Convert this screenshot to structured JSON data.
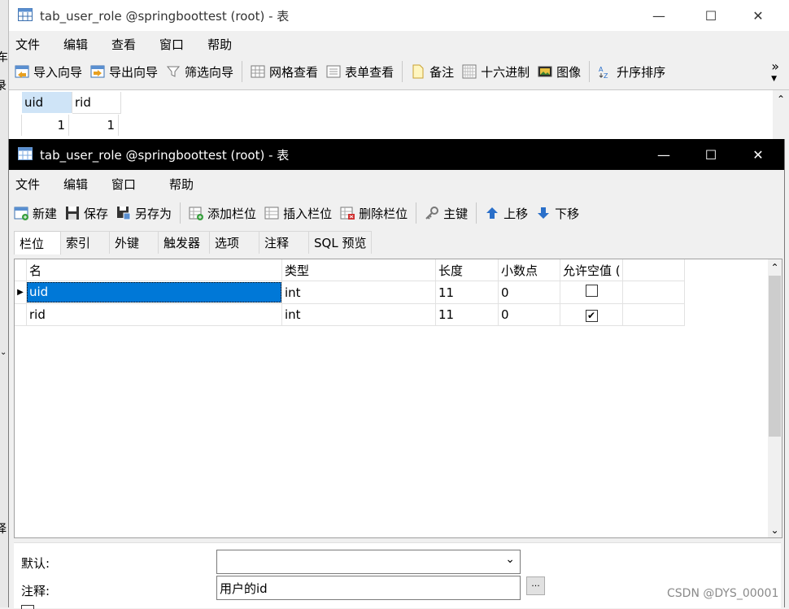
{
  "bg_window": {
    "title": "tab_user_role @springboottest (root) - 表",
    "menu": [
      "文件",
      "编辑",
      "查看",
      "窗口",
      "帮助"
    ],
    "toolbar": [
      {
        "label": "导入向导",
        "icon": "import-wizard-icon"
      },
      {
        "label": "导出向导",
        "icon": "export-wizard-icon"
      },
      {
        "label": "筛选向导",
        "icon": "filter-funnel-icon"
      },
      {
        "label": "网格查看",
        "icon": "grid-view-icon"
      },
      {
        "label": "表单查看",
        "icon": "form-view-icon"
      },
      {
        "label": "备注",
        "icon": "note-icon"
      },
      {
        "label": "十六进制",
        "icon": "hex-icon"
      },
      {
        "label": "图像",
        "icon": "image-icon"
      },
      {
        "label": "升序排序",
        "icon": "sort-ascending-icon"
      }
    ],
    "overflow": "»",
    "columns": [
      "uid",
      "rid"
    ],
    "row": [
      "1",
      "1"
    ]
  },
  "left_edge_fragments": [
    "车",
    "录",
    "择",
    "置"
  ],
  "front_window": {
    "title": "tab_user_role @springboottest (root) - 表",
    "menu": [
      "文件",
      "编辑",
      "窗口",
      "帮助"
    ],
    "toolbar": [
      {
        "label": "新建",
        "icon": "new-table-icon"
      },
      {
        "label": "保存",
        "icon": "save-disk-icon"
      },
      {
        "label": "另存为",
        "icon": "save-as-icon"
      },
      {
        "label": "添加栏位",
        "icon": "add-field-icon"
      },
      {
        "label": "插入栏位",
        "icon": "insert-field-icon"
      },
      {
        "label": "删除栏位",
        "icon": "delete-field-icon"
      },
      {
        "label": "主键",
        "icon": "key-icon"
      },
      {
        "label": "上移",
        "icon": "arrow-up-icon"
      },
      {
        "label": "下移",
        "icon": "arrow-down-icon"
      }
    ],
    "tabs": [
      "栏位",
      "索引",
      "外键",
      "触发器",
      "选项",
      "注释",
      "SQL 预览"
    ],
    "grid": {
      "headers": [
        "名",
        "类型",
        "长度",
        "小数点",
        "允许空值 ("
      ],
      "rows": [
        {
          "name": "uid",
          "type": "int",
          "length": "11",
          "decimals": "0",
          "nullable": false,
          "selected": true
        },
        {
          "name": "rid",
          "type": "int",
          "length": "11",
          "decimals": "0",
          "nullable": true,
          "selected": false
        }
      ]
    },
    "props": {
      "default_label": "默认:",
      "default_value": "",
      "comment_label": "注释:",
      "comment_value": "用户的id",
      "ellipsis": "..."
    }
  },
  "watermark": "CSDN @DYS_00001",
  "colors": {
    "selection": "#0078d7",
    "title_dark": "#000000",
    "accent_blue": "#2a6fc9"
  }
}
